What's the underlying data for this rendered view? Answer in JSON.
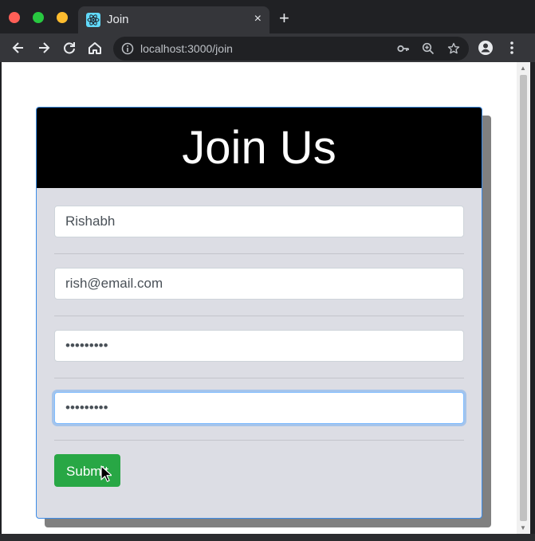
{
  "browser": {
    "tab_title": "Join",
    "tab_close": "×",
    "new_tab": "+",
    "url": "localhost:3000/join"
  },
  "form": {
    "title": "Join Us",
    "name_value": "Rishabh",
    "email_value": "rish@email.com",
    "password_value": "•••••••••",
    "confirm_password_value": "•••••••••",
    "submit_label": "Submit"
  },
  "colors": {
    "header_bg": "#000000",
    "card_bg": "#dcdde4",
    "submit_bg": "#28a745",
    "focus_border": "#80bdff"
  },
  "icons": [
    "react-favicon-icon",
    "back-icon",
    "forward-icon",
    "reload-icon",
    "home-icon",
    "info-icon",
    "key-icon",
    "zoom-icon",
    "star-icon",
    "account-icon",
    "menu-icon"
  ]
}
